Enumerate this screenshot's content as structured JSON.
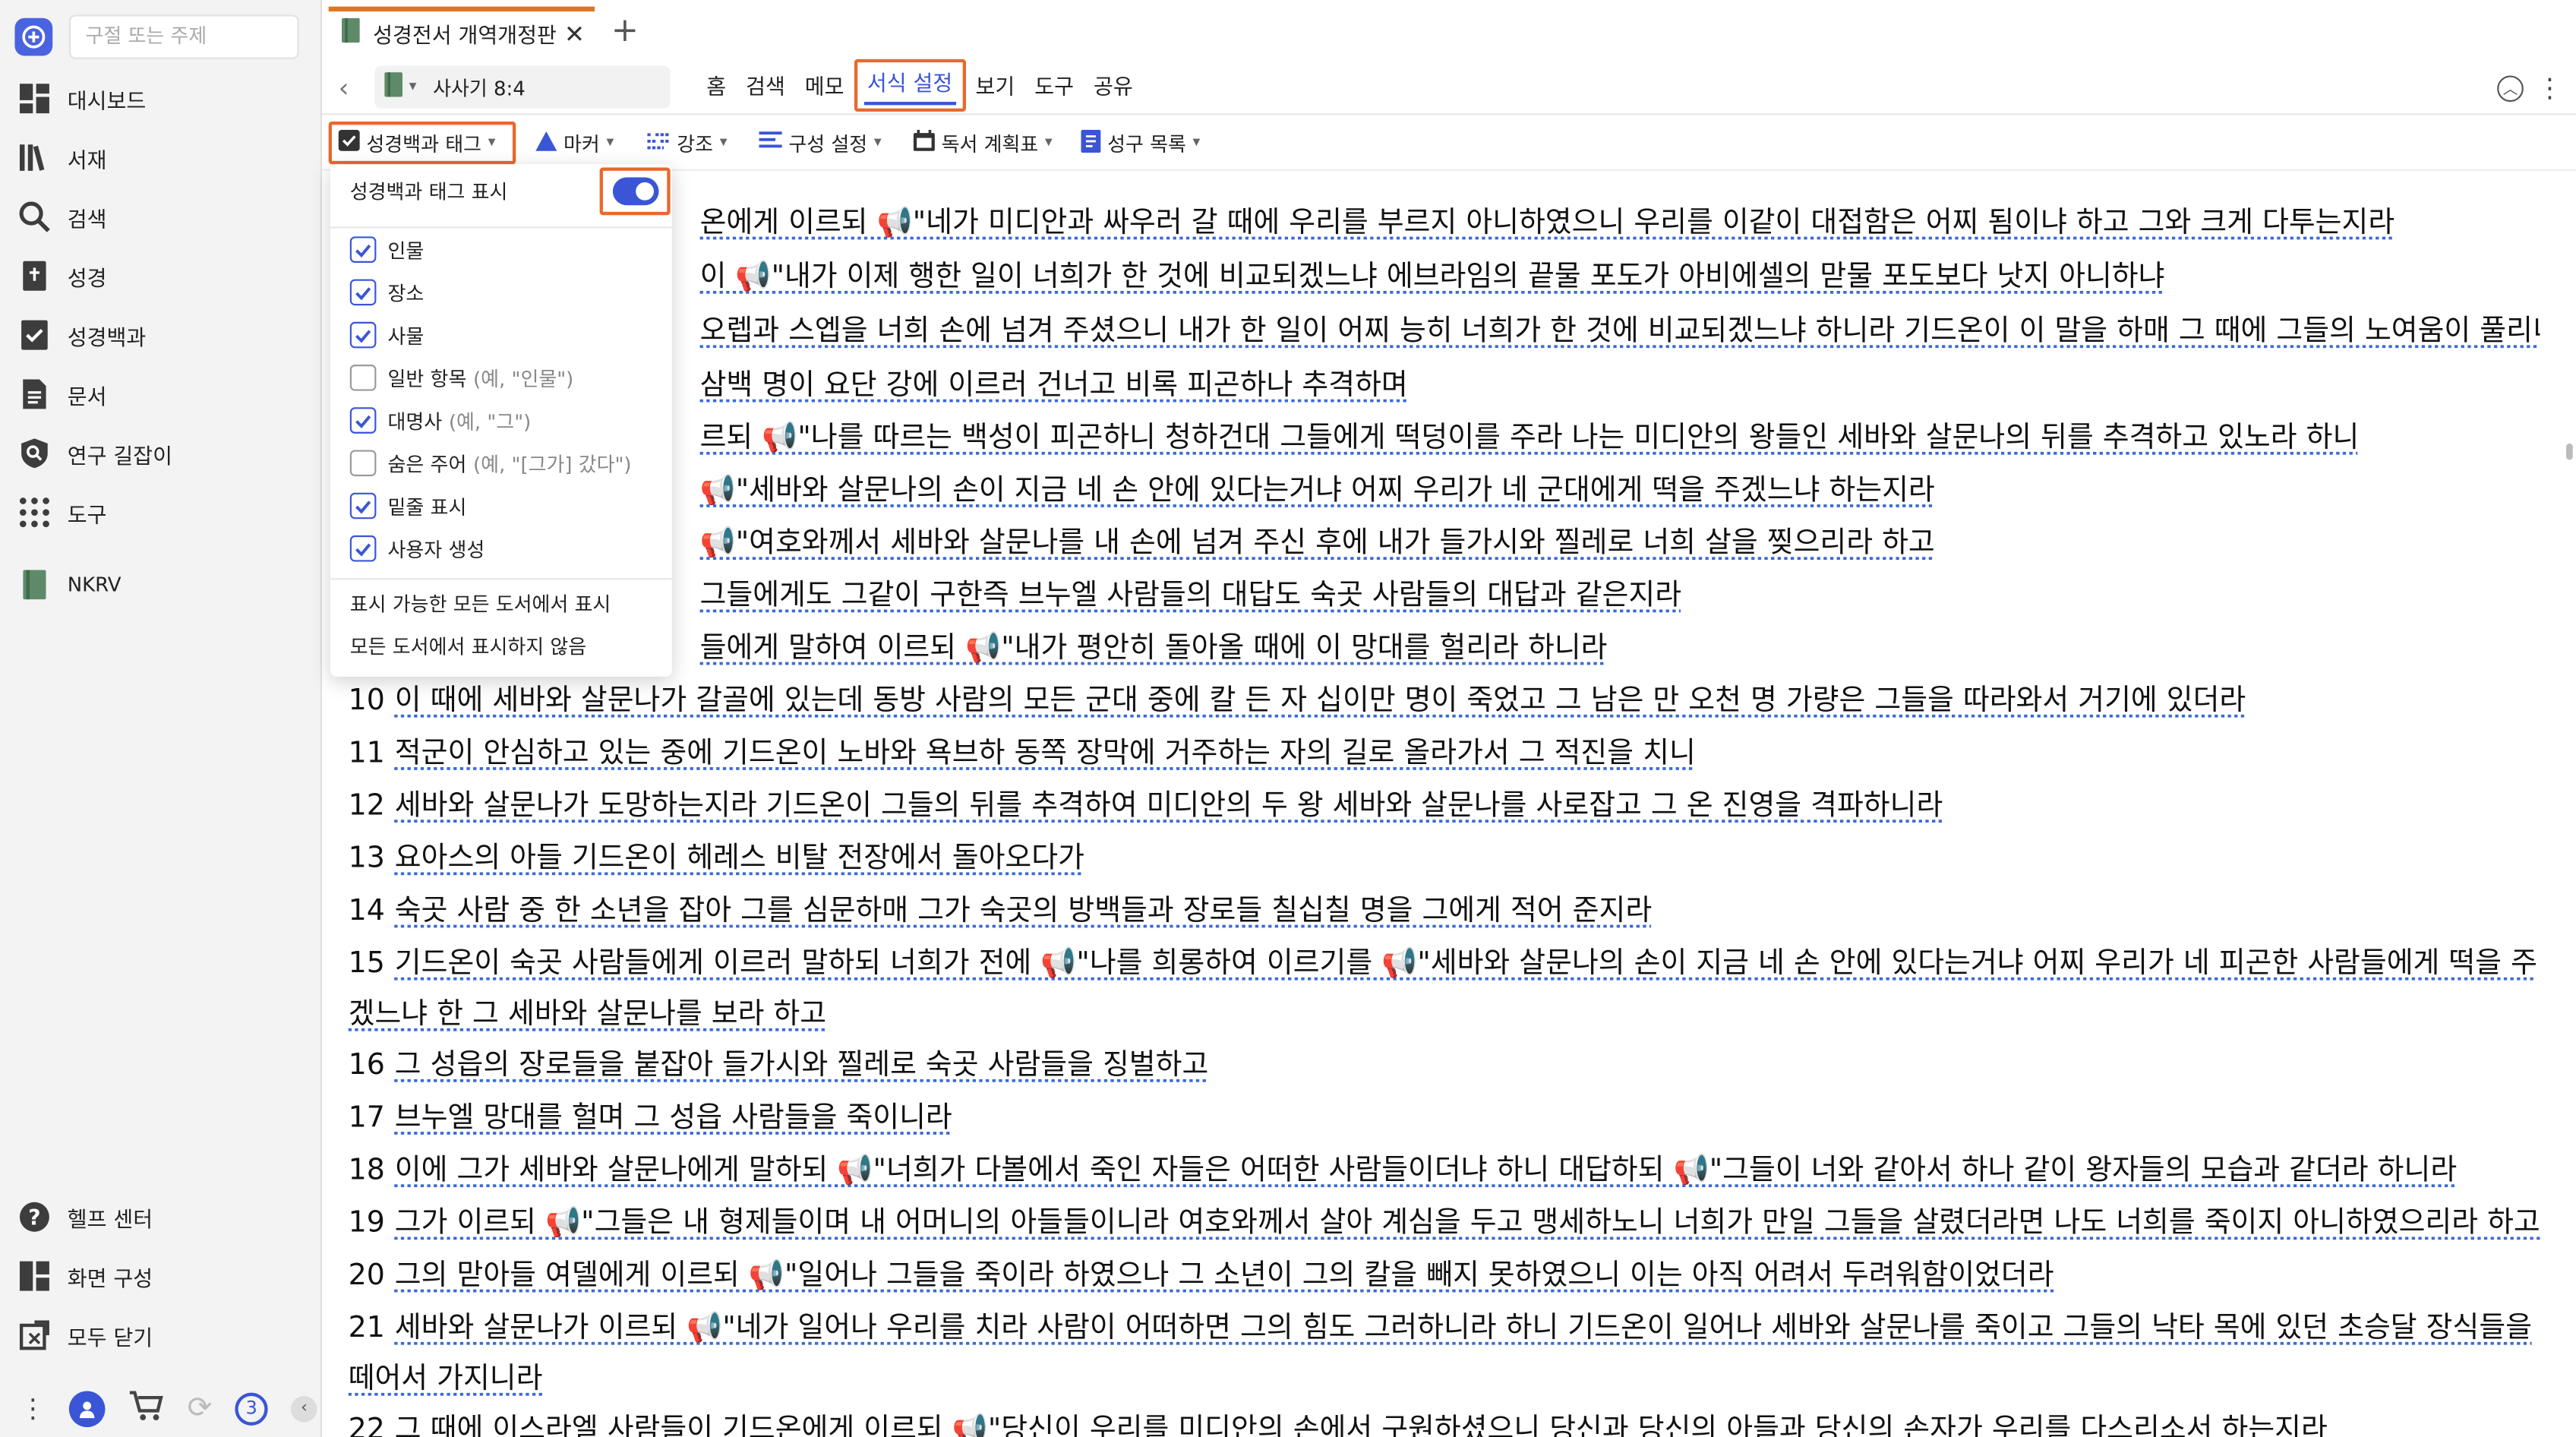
{
  "sidebar": {
    "search_placeholder": "구절 또는 주제",
    "items": [
      {
        "label": "대시보드",
        "icon": "dashboard-icon"
      },
      {
        "label": "서재",
        "icon": "library-icon"
      },
      {
        "label": "검색",
        "icon": "search-icon"
      },
      {
        "label": "성경",
        "icon": "bible-icon"
      },
      {
        "label": "성경백과",
        "icon": "encyclopedia-icon"
      },
      {
        "label": "문서",
        "icon": "document-icon"
      },
      {
        "label": "연구 길잡이",
        "icon": "study-guide-icon"
      },
      {
        "label": "도구",
        "icon": "tools-icon"
      }
    ],
    "book": "NKRV",
    "bottom_items": [
      {
        "label": "헬프 센터",
        "icon": "help-icon"
      },
      {
        "label": "화면 구성",
        "icon": "layout-icon"
      },
      {
        "label": "모두 닫기",
        "icon": "close-all-icon"
      }
    ],
    "sync_badge": "3"
  },
  "tab": {
    "title": "성경전서 개역개정판"
  },
  "toolbar": {
    "reference": "사사기 8:4",
    "menu": [
      "홈",
      "검색",
      "메모",
      "서식 설정",
      "보기",
      "도구",
      "공유"
    ],
    "active_menu": "서식 설정"
  },
  "format_bar": {
    "tags": "성경백과 태그",
    "marker": "마커",
    "emphasis": "강조",
    "layout": "구성 설정",
    "reading_plan": "독서 계획표",
    "verse_list": "성구 목록"
  },
  "dropdown": {
    "header": "성경백과 태그 표시",
    "toggle_on": true,
    "options": [
      {
        "label": "인물",
        "hint": "",
        "checked": true
      },
      {
        "label": "장소",
        "hint": "",
        "checked": true
      },
      {
        "label": "사물",
        "hint": "",
        "checked": true
      },
      {
        "label": "일반 항목",
        "hint": "(예, \"인물\")",
        "checked": false
      },
      {
        "label": "대명사",
        "hint": "(예, \"그\")",
        "checked": true
      },
      {
        "label": "숨은 주어",
        "hint": "(예, \"[그가] 갔다\")",
        "checked": false
      },
      {
        "label": "밑줄 표시",
        "hint": "",
        "checked": true
      },
      {
        "label": "사용자 생성",
        "hint": "",
        "checked": true
      }
    ],
    "show_all": "표시 가능한 모든 도서에서 표시",
    "hide_all": "모든 도서에서 표시하지 않음"
  },
  "verses": [
    {
      "n": "",
      "text": "온에게 이르되 📢\"네가 미디안과 싸우러 갈 때에 우리를 부르지 아니하였으니 우리를 이같이 대접함은 어찌 됨이냐 하고 그와 크게 다투는지라"
    },
    {
      "n": "",
      "text": "이 📢\"내가 이제 행한 일이 너희가 한 것에 비교되겠느냐 에브라임의 끝물 포도가 아비에셀의 맏물 포도보다 낫지 아니하냐"
    },
    {
      "n": "",
      "text": "오렙과 스엡을 너희 손에 넘겨 주셨으니 내가 한 일이 어찌 능히 너희가 한 것에 비교되겠느냐 하니라 기드온이 이 말을 하매 그 때에 그들의 노여움이 풀리니라"
    },
    {
      "n": "",
      "text": "삼백 명이 요단 강에 이르러 건너고 비록 피곤하나 추격하며"
    },
    {
      "n": "",
      "text": "르되 📢\"나를 따르는 백성이 피곤하니 청하건대 그들에게 떡덩이를 주라 나는 미디안의 왕들인 세바와 살문나의 뒤를 추격하고 있노라 하니"
    },
    {
      "n": "",
      "text": "📢\"세바와 살문나의 손이 지금 네 손 안에 있다는거냐 어찌 우리가 네 군대에게 떡을 주겠느냐 하는지라"
    },
    {
      "n": "",
      "text": "📢\"여호와께서 세바와 살문나를 내 손에 넘겨 주신 후에 내가 들가시와 찔레로 너희 살을 찢으리라 하고"
    },
    {
      "n": "",
      "text": "그들에게도 그같이 구한즉 브누엘 사람들의 대답도 숙곳 사람들의 대답과 같은지라"
    },
    {
      "n": "",
      "text": "들에게 말하여 이르되 📢\"내가 평안히 돌아올 때에 이 망대를 헐리라 하니라"
    },
    {
      "n": "10",
      "text": "이 때에 세바와 살문나가 갈골에 있는데 동방 사람의 모든 군대 중에 칼 든 자 십이만 명이 죽었고 그 남은 만 오천 명 가량은 그들을 따라와서 거기에 있더라"
    },
    {
      "n": "11",
      "text": "적군이 안심하고 있는 중에 기드온이 노바와 욕브하 동쪽 장막에 거주하는 자의 길로 올라가서 그 적진을 치니"
    },
    {
      "n": "12",
      "text": "세바와 살문나가 도망하는지라 기드온이 그들의 뒤를 추격하여 미디안의 두 왕 세바와 살문나를 사로잡고 그 온 진영을 격파하니라"
    },
    {
      "n": "13",
      "text": "요아스의 아들 기드온이 헤레스 비탈 전장에서 돌아오다가"
    },
    {
      "n": "14",
      "text": "숙곳 사람 중 한 소년을 잡아 그를 심문하매 그가 숙곳의 방백들과 장로들 칠십칠 명을 그에게 적어 준지라"
    },
    {
      "n": "15",
      "text": "기드온이 숙곳 사람들에게 이르러 말하되 너희가 전에 📢\"나를 희롱하여 이르기를 📢\"세바와 살문나의 손이 지금 네 손 안에 있다는거냐 어찌 우리가 네 피곤한 사람들에게 떡을 주겠느냐 한 그 세바와 살문나를 보라 하고"
    },
    {
      "n": "16",
      "text": "그 성읍의 장로들을 붙잡아 들가시와 찔레로 숙곳 사람들을 징벌하고"
    },
    {
      "n": "17",
      "text": "브누엘 망대를 헐며 그 성읍 사람들을 죽이니라"
    },
    {
      "n": "18",
      "text": "이에 그가 세바와 살문나에게 말하되 📢\"너희가 다볼에서 죽인 자들은 어떠한 사람들이더냐 하니 대답하되 📢\"그들이 너와 같아서 하나 같이 왕자들의 모습과 같더라 하니라"
    },
    {
      "n": "19",
      "text": "그가 이르되 📢\"그들은 내 형제들이며 내 어머니의 아들들이니라 여호와께서 살아 계심을 두고 맹세하노니 너희가 만일 그들을 살렸더라면 나도 너희를 죽이지 아니하였으리라 하고"
    },
    {
      "n": "20",
      "text": "그의 맏아들 여델에게 이르되 📢\"일어나 그들을 죽이라 하였으나 그 소년이 그의 칼을 빼지 못하였으니 이는 아직 어려서 두려워함이었더라"
    },
    {
      "n": "21",
      "text": "세바와 살문나가 이르되 📢\"네가 일어나 우리를 치라 사람이 어떠하면 그의 힘도 그러하니라 하니 기드온이 일어나 세바와 살문나를 죽이고 그들의 낙타 목에 있던 초승달 장식들을 떼어서 가지니라"
    },
    {
      "n": "22",
      "text": "그 때에 이스라엘 사람들이 기드온에게 이르되 📢\"당신이 우리를 미디안의 손에서 구원하셨으니 당신과 당신의 아들과 당신의 손자가 우리를 다스리소서 하는지라"
    }
  ]
}
